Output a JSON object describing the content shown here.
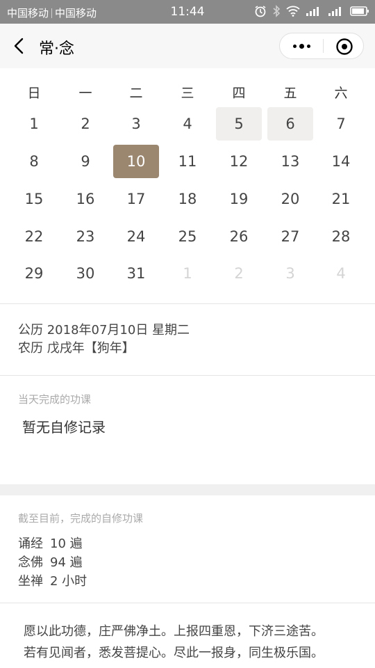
{
  "statusbar": {
    "carrier1": "中国移动",
    "carrier2": "中国移动",
    "time": "11:44",
    "battery_level": 0.8
  },
  "nav": {
    "title": "常·念"
  },
  "calendar": {
    "weekdays": [
      "日",
      "一",
      "二",
      "三",
      "四",
      "五",
      "六"
    ],
    "weeks": [
      [
        "1",
        "2",
        "3",
        "4",
        "5",
        "6",
        "7"
      ],
      [
        "8",
        "9",
        "10",
        "11",
        "12",
        "13",
        "14"
      ],
      [
        "15",
        "16",
        "17",
        "18",
        "19",
        "20",
        "21"
      ],
      [
        "22",
        "23",
        "24",
        "25",
        "26",
        "27",
        "28"
      ],
      [
        "29",
        "30",
        "31",
        "1",
        "2",
        "3",
        "4"
      ]
    ],
    "selected_day": "10",
    "marked_days": [
      "5",
      "6"
    ],
    "next_month_days_in_last_row": 4,
    "selected_color": "#9b8670",
    "marked_color": "#f0efed"
  },
  "date_info": {
    "solar": "公历 2018年07月10日 星期二",
    "lunar": "农历 戊戌年【狗年】"
  },
  "today_section": {
    "label": "当天完成的功课",
    "empty_text": "暂无自修记录"
  },
  "summary_section": {
    "label": "截至目前，完成的自修功课",
    "items": [
      {
        "name": "诵经",
        "value": "10 遍"
      },
      {
        "name": "念佛",
        "value": "94 遍"
      },
      {
        "name": "坐禅",
        "value": "2 小时"
      }
    ]
  },
  "verse": {
    "line1": "愿以此功德，庄严佛净土。上报四重恩，下济三途苦。",
    "line2": "若有见闻者，悉发菩提心。尽此一报身，同生极乐国。"
  }
}
